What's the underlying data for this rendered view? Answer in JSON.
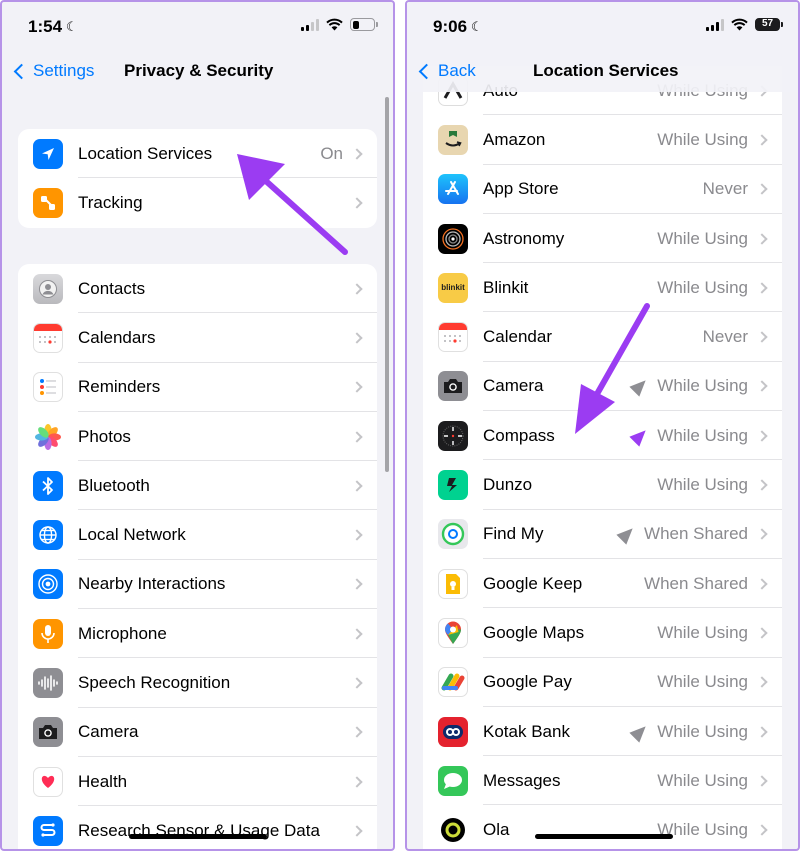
{
  "left": {
    "time": "1:54",
    "nav_back": "Settings",
    "nav_title": "Privacy & Security",
    "group1": [
      {
        "label": "Location Services",
        "value": "On"
      },
      {
        "label": "Tracking",
        "value": ""
      }
    ],
    "group2": [
      {
        "label": "Contacts",
        "icon": "contacts-icon"
      },
      {
        "label": "Calendars",
        "icon": "calendar-icon"
      },
      {
        "label": "Reminders",
        "icon": "reminders-icon"
      },
      {
        "label": "Photos",
        "icon": "photos-icon"
      },
      {
        "label": "Bluetooth",
        "icon": "bluetooth-icon"
      },
      {
        "label": "Local Network",
        "icon": "globe-icon"
      },
      {
        "label": "Nearby Interactions",
        "icon": "nearby-icon"
      },
      {
        "label": "Microphone",
        "icon": "microphone-icon"
      },
      {
        "label": "Speech Recognition",
        "icon": "waveform-icon"
      },
      {
        "label": "Camera",
        "icon": "camera-icon"
      },
      {
        "label": "Health",
        "icon": "heart-icon"
      },
      {
        "label": "Research Sensor & Usage Data",
        "icon": "research-icon"
      }
    ]
  },
  "right": {
    "time": "9:06",
    "battery": "57",
    "nav_back": "Back",
    "nav_title": "Location Services",
    "apps": [
      {
        "label": "Auto",
        "value": "While Using"
      },
      {
        "label": "Amazon",
        "value": "While Using"
      },
      {
        "label": "App Store",
        "value": "Never"
      },
      {
        "label": "Astronomy",
        "value": "While Using"
      },
      {
        "label": "Blinkit",
        "value": "While Using",
        "icon_text": "blinkit"
      },
      {
        "label": "Calendar",
        "value": "Never"
      },
      {
        "label": "Camera",
        "value": "While Using"
      },
      {
        "label": "Compass",
        "value": "While Using"
      },
      {
        "label": "Dunzo",
        "value": "While Using"
      },
      {
        "label": "Find My",
        "value": "When Shared"
      },
      {
        "label": "Google Keep",
        "value": "When Shared"
      },
      {
        "label": "Google Maps",
        "value": "While Using"
      },
      {
        "label": "Google Pay",
        "value": "While Using"
      },
      {
        "label": "Kotak Bank",
        "value": "While Using"
      },
      {
        "label": "Messages",
        "value": "While Using"
      },
      {
        "label": "Ola",
        "value": "While Using"
      }
    ]
  },
  "colors": {
    "accent": "#007aff",
    "annotation": "#9b3cf2",
    "frame": "#b693e8"
  }
}
